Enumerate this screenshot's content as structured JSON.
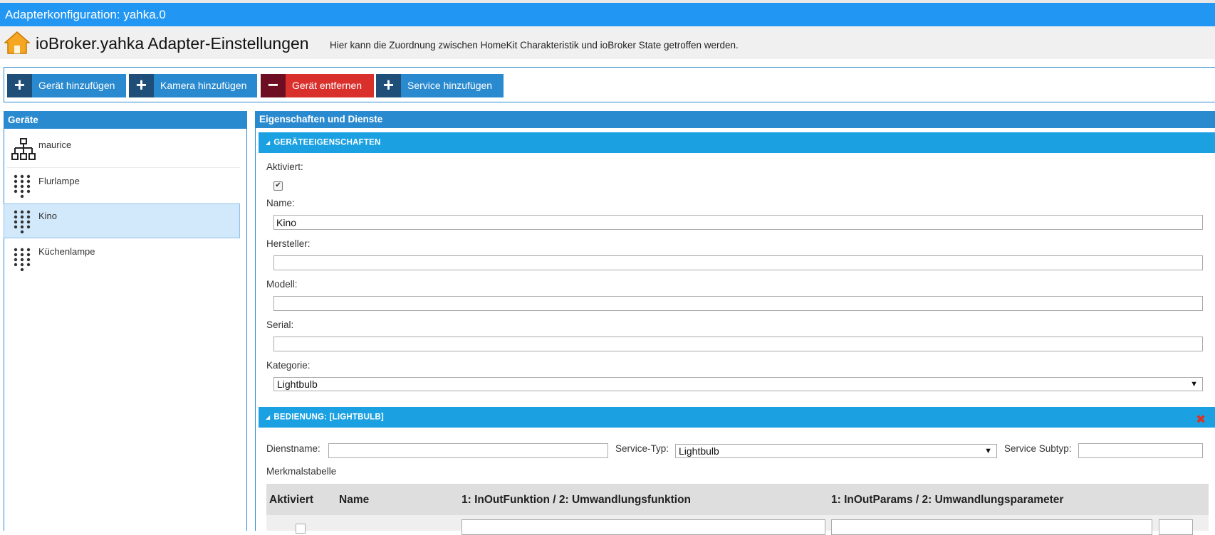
{
  "window": {
    "title": "Adapterkonfiguration: yahka.0"
  },
  "header": {
    "title": "ioBroker.yahka Adapter-Einstellungen",
    "subtitle": "Hier kann die Zuordnung zwischen HomeKit Charakteristik und ioBroker State getroffen werden."
  },
  "toolbar": {
    "add_device": "Gerät hinzufügen",
    "add_camera": "Kamera hinzufügen",
    "remove_device": "Gerät entfernen",
    "add_service": "Service hinzufügen",
    "plus_glyph": "+",
    "minus_glyph": "−"
  },
  "devices": {
    "title": "Geräte",
    "items": [
      {
        "label": "maurice",
        "icon": "network-tree-icon"
      },
      {
        "label": "Flurlampe",
        "icon": "dot-grid-icon"
      },
      {
        "label": "Kino",
        "icon": "dot-grid-icon",
        "selected": true
      },
      {
        "label": "Küchenlampe",
        "icon": "dot-grid-icon"
      }
    ]
  },
  "props": {
    "title": "Eigenschaften und Dienste",
    "section1": "GERÄTEEIGENSCHAFTEN",
    "section2": "BEDIENUNG: [LIGHTBULB]",
    "aktiviert_label": "Aktiviert:",
    "aktiviert_checked": true,
    "check_glyph": "✔",
    "name_label": "Name:",
    "name_value": "Kino",
    "hersteller_label": "Hersteller:",
    "hersteller_value": "",
    "modell_label": "Modell:",
    "modell_value": "",
    "serial_label": "Serial:",
    "serial_value": "",
    "kategorie_label": "Kategorie:",
    "kategorie_value": "Lightbulb",
    "dropdown_arrow": "▼",
    "close_glyph": "✖"
  },
  "service": {
    "dienstname_label": "Dienstname:",
    "dienstname_value": "",
    "servicetyp_label": "Service-Typ:",
    "servicetyp_value": "Lightbulb",
    "subtyp_label": "Service Subtyp:",
    "subtyp_value": "",
    "merkmal_label": "Merkmalstabelle"
  },
  "table": {
    "col_aktiviert": "Aktiviert",
    "col_name": "Name",
    "col_function": "1: InOutFunktion / 2: Umwandlungsfunktion",
    "col_params": "1: InOutParams / 2: Umwandlungsparameter"
  },
  "colors": {
    "titlebar": "#2196f3",
    "button": "#2a8ad0",
    "button_dark": "#1f4e79",
    "danger": "#d9302c",
    "section": "#1ba1e2",
    "selected": "#d2e8fb"
  }
}
